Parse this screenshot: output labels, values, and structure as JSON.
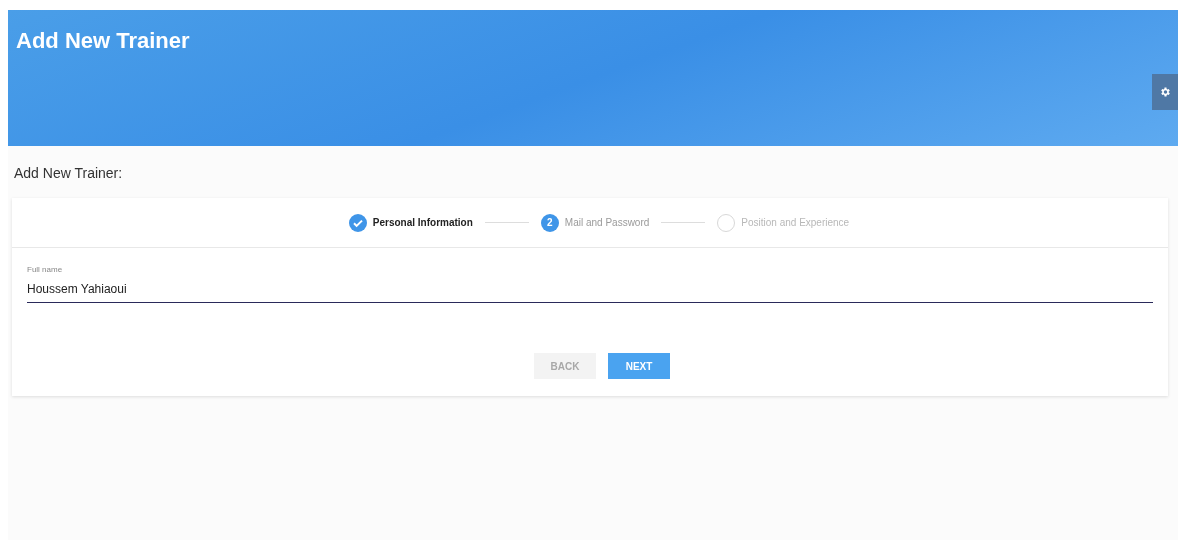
{
  "header": {
    "title": "Add New Trainer"
  },
  "form": {
    "title": "Add New Trainer:",
    "steps": [
      {
        "label": "Personal Information",
        "kind": "done"
      },
      {
        "label": "Mail and Password",
        "kind": "active",
        "number": "2"
      },
      {
        "label": "Position and Experience",
        "kind": "pending"
      }
    ],
    "field": {
      "label": "Full name",
      "value": "Houssem Yahiaoui"
    },
    "buttons": [
      {
        "label": "BACK",
        "disabled": true,
        "kind": "back"
      },
      {
        "label": "NEXT",
        "disabled": false,
        "kind": "next"
      }
    ]
  }
}
